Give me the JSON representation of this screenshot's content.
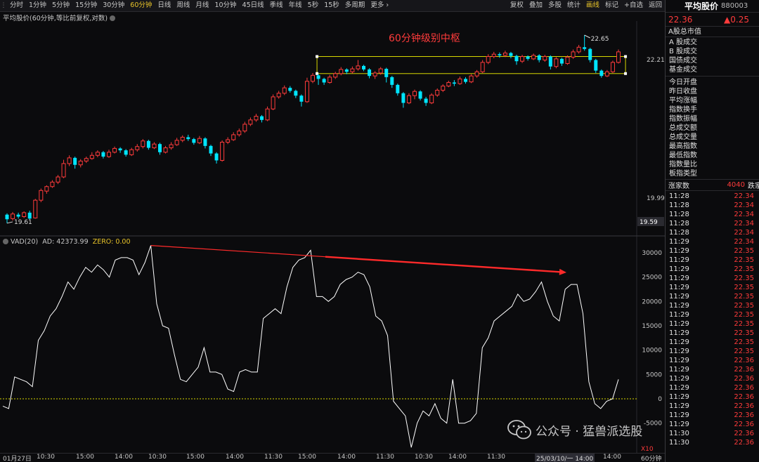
{
  "toolbar": {
    "tabs": [
      "分时",
      "1分钟",
      "5分钟",
      "15分钟",
      "30分钟",
      "60分钟",
      "日线",
      "周线",
      "月线",
      "10分钟",
      "45日线",
      "季线",
      "年线",
      "5秒",
      "15秒",
      "多周期",
      "更多 ›"
    ],
    "active_tab": "60分钟",
    "buttons": [
      "复权",
      "叠加",
      "多股",
      "统计",
      "画线",
      "标记",
      "+自选",
      "返回"
    ],
    "active_button": "画线"
  },
  "main_chart": {
    "title": "平均股价(60分钟,等比前复权,对数)",
    "annotation": "60分钟级别中枢",
    "high_label": "22.65",
    "low_label": "19.61",
    "axis_ticks": [
      "22.21",
      "19.99"
    ],
    "current_value_box": "19.59",
    "colors": {
      "up": "#ff3b3b",
      "down": "#00e5ff",
      "box": "#d8d800",
      "annotation": "#ff3b3b"
    },
    "candles": [
      {
        "o": 19.73,
        "c": 19.66,
        "h": 19.75,
        "l": 19.6
      },
      {
        "o": 19.67,
        "c": 19.74,
        "h": 19.77,
        "l": 19.64
      },
      {
        "o": 19.73,
        "c": 19.7,
        "h": 19.76,
        "l": 19.67
      },
      {
        "o": 19.7,
        "c": 19.76,
        "h": 19.78,
        "l": 19.68
      },
      {
        "o": 19.76,
        "c": 19.67,
        "h": 19.79,
        "l": 19.66
      },
      {
        "o": 19.68,
        "c": 19.95,
        "h": 19.97,
        "l": 19.67
      },
      {
        "o": 19.95,
        "c": 20.1,
        "h": 20.13,
        "l": 19.92
      },
      {
        "o": 20.09,
        "c": 20.16,
        "h": 20.18,
        "l": 20.05
      },
      {
        "o": 20.16,
        "c": 20.23,
        "h": 20.26,
        "l": 20.14
      },
      {
        "o": 20.23,
        "c": 20.31,
        "h": 20.34,
        "l": 20.2
      },
      {
        "o": 20.31,
        "c": 20.52,
        "h": 20.58,
        "l": 20.29
      },
      {
        "o": 20.52,
        "c": 20.61,
        "h": 20.65,
        "l": 20.48
      },
      {
        "o": 20.61,
        "c": 20.5,
        "h": 20.63,
        "l": 20.44
      },
      {
        "o": 20.5,
        "c": 20.56,
        "h": 20.59,
        "l": 20.46
      },
      {
        "o": 20.56,
        "c": 20.6,
        "h": 20.63,
        "l": 20.53
      },
      {
        "o": 20.6,
        "c": 20.65,
        "h": 20.7,
        "l": 20.58
      },
      {
        "o": 20.65,
        "c": 20.7,
        "h": 20.73,
        "l": 20.62
      },
      {
        "o": 20.7,
        "c": 20.63,
        "h": 20.72,
        "l": 20.6
      },
      {
        "o": 20.63,
        "c": 20.7,
        "h": 20.74,
        "l": 20.61
      },
      {
        "o": 20.7,
        "c": 20.76,
        "h": 20.79,
        "l": 20.68
      },
      {
        "o": 20.76,
        "c": 20.73,
        "h": 20.78,
        "l": 20.69
      },
      {
        "o": 20.73,
        "c": 20.66,
        "h": 20.75,
        "l": 20.63
      },
      {
        "o": 20.66,
        "c": 20.74,
        "h": 20.77,
        "l": 20.64
      },
      {
        "o": 20.74,
        "c": 20.79,
        "h": 20.83,
        "l": 20.71
      },
      {
        "o": 20.79,
        "c": 20.88,
        "h": 20.91,
        "l": 20.76
      },
      {
        "o": 20.88,
        "c": 20.77,
        "h": 20.9,
        "l": 20.74
      },
      {
        "o": 20.77,
        "c": 20.83,
        "h": 20.86,
        "l": 20.75
      },
      {
        "o": 20.83,
        "c": 20.7,
        "h": 20.85,
        "l": 20.66
      },
      {
        "o": 20.7,
        "c": 20.77,
        "h": 20.8,
        "l": 20.68
      },
      {
        "o": 20.77,
        "c": 20.82,
        "h": 20.86,
        "l": 20.74
      },
      {
        "o": 20.82,
        "c": 20.89,
        "h": 20.93,
        "l": 20.8
      },
      {
        "o": 20.89,
        "c": 20.94,
        "h": 20.97,
        "l": 20.86
      },
      {
        "o": 20.94,
        "c": 20.91,
        "h": 20.98,
        "l": 20.88
      },
      {
        "o": 20.91,
        "c": 20.85,
        "h": 20.93,
        "l": 20.82
      },
      {
        "o": 20.85,
        "c": 20.92,
        "h": 20.96,
        "l": 20.83
      },
      {
        "o": 20.92,
        "c": 20.8,
        "h": 20.94,
        "l": 20.76
      },
      {
        "o": 20.8,
        "c": 20.68,
        "h": 20.82,
        "l": 20.64
      },
      {
        "o": 20.68,
        "c": 20.57,
        "h": 20.7,
        "l": 20.52
      },
      {
        "o": 20.57,
        "c": 20.86,
        "h": 20.89,
        "l": 20.55
      },
      {
        "o": 20.86,
        "c": 20.9,
        "h": 20.94,
        "l": 20.83
      },
      {
        "o": 20.9,
        "c": 20.98,
        "h": 21.02,
        "l": 20.88
      },
      {
        "o": 20.98,
        "c": 21.04,
        "h": 21.08,
        "l": 20.95
      },
      {
        "o": 21.04,
        "c": 21.15,
        "h": 21.19,
        "l": 21.01
      },
      {
        "o": 21.15,
        "c": 21.22,
        "h": 21.26,
        "l": 21.12
      },
      {
        "o": 21.22,
        "c": 21.28,
        "h": 21.32,
        "l": 21.19
      },
      {
        "o": 21.28,
        "c": 21.22,
        "h": 21.3,
        "l": 21.18
      },
      {
        "o": 21.22,
        "c": 21.4,
        "h": 21.44,
        "l": 21.2
      },
      {
        "o": 21.4,
        "c": 21.6,
        "h": 21.64,
        "l": 21.38
      },
      {
        "o": 21.6,
        "c": 21.66,
        "h": 21.7,
        "l": 21.57
      },
      {
        "o": 21.66,
        "c": 21.75,
        "h": 21.79,
        "l": 21.63
      },
      {
        "o": 21.75,
        "c": 21.7,
        "h": 21.78,
        "l": 21.67
      },
      {
        "o": 21.7,
        "c": 21.62,
        "h": 21.72,
        "l": 21.58
      },
      {
        "o": 21.62,
        "c": 21.52,
        "h": 21.64,
        "l": 21.44
      },
      {
        "o": 21.52,
        "c": 21.86,
        "h": 21.92,
        "l": 21.5
      },
      {
        "o": 21.86,
        "c": 21.96,
        "h": 22.0,
        "l": 21.83
      },
      {
        "o": 21.96,
        "c": 21.9,
        "h": 21.98,
        "l": 21.8
      },
      {
        "o": 21.9,
        "c": 21.84,
        "h": 21.92,
        "l": 21.8
      },
      {
        "o": 21.84,
        "c": 21.93,
        "h": 21.97,
        "l": 21.82
      },
      {
        "o": 21.93,
        "c": 21.99,
        "h": 22.02,
        "l": 21.9
      },
      {
        "o": 21.99,
        "c": 22.06,
        "h": 22.1,
        "l": 21.96
      },
      {
        "o": 22.06,
        "c": 22.02,
        "h": 22.08,
        "l": 21.98
      },
      {
        "o": 22.02,
        "c": 22.07,
        "h": 22.11,
        "l": 21.99
      },
      {
        "o": 22.07,
        "c": 22.12,
        "h": 22.22,
        "l": 22.04
      },
      {
        "o": 22.12,
        "c": 22.06,
        "h": 22.14,
        "l": 22.03
      },
      {
        "o": 22.06,
        "c": 21.95,
        "h": 22.08,
        "l": 21.91
      },
      {
        "o": 21.95,
        "c": 22.0,
        "h": 22.03,
        "l": 21.9
      },
      {
        "o": 22.0,
        "c": 22.07,
        "h": 22.1,
        "l": 21.97
      },
      {
        "o": 22.07,
        "c": 21.93,
        "h": 22.09,
        "l": 21.84
      },
      {
        "o": 21.93,
        "c": 21.8,
        "h": 21.95,
        "l": 21.75
      },
      {
        "o": 21.8,
        "c": 21.66,
        "h": 21.82,
        "l": 21.62
      },
      {
        "o": 21.66,
        "c": 21.5,
        "h": 21.68,
        "l": 21.42
      },
      {
        "o": 21.5,
        "c": 21.62,
        "h": 21.66,
        "l": 21.48
      },
      {
        "o": 21.62,
        "c": 21.69,
        "h": 21.72,
        "l": 21.56
      },
      {
        "o": 21.69,
        "c": 21.57,
        "h": 21.71,
        "l": 21.54
      },
      {
        "o": 21.57,
        "c": 21.5,
        "h": 21.6,
        "l": 21.45
      },
      {
        "o": 21.5,
        "c": 21.63,
        "h": 21.66,
        "l": 21.48
      },
      {
        "o": 21.63,
        "c": 21.71,
        "h": 21.74,
        "l": 21.6
      },
      {
        "o": 21.71,
        "c": 21.78,
        "h": 21.81,
        "l": 21.68
      },
      {
        "o": 21.78,
        "c": 21.84,
        "h": 21.87,
        "l": 21.76
      },
      {
        "o": 21.84,
        "c": 21.82,
        "h": 21.88,
        "l": 21.78
      },
      {
        "o": 21.82,
        "c": 21.9,
        "h": 21.94,
        "l": 21.8
      },
      {
        "o": 21.9,
        "c": 21.85,
        "h": 21.93,
        "l": 21.82
      },
      {
        "o": 21.85,
        "c": 21.95,
        "h": 21.98,
        "l": 21.83
      },
      {
        "o": 21.95,
        "c": 22.02,
        "h": 22.05,
        "l": 21.92
      },
      {
        "o": 22.02,
        "c": 22.18,
        "h": 22.22,
        "l": 22.0
      },
      {
        "o": 22.18,
        "c": 22.28,
        "h": 22.32,
        "l": 22.15
      },
      {
        "o": 22.28,
        "c": 22.32,
        "h": 22.36,
        "l": 22.25
      },
      {
        "o": 22.32,
        "c": 22.3,
        "h": 22.35,
        "l": 22.26
      },
      {
        "o": 22.3,
        "c": 22.34,
        "h": 22.38,
        "l": 22.27
      },
      {
        "o": 22.34,
        "c": 22.29,
        "h": 22.36,
        "l": 22.25
      },
      {
        "o": 22.29,
        "c": 22.2,
        "h": 22.31,
        "l": 22.14
      },
      {
        "o": 22.2,
        "c": 22.28,
        "h": 22.31,
        "l": 22.17
      },
      {
        "o": 22.28,
        "c": 22.24,
        "h": 22.3,
        "l": 22.21
      },
      {
        "o": 22.24,
        "c": 22.3,
        "h": 22.33,
        "l": 22.22
      },
      {
        "o": 22.3,
        "c": 22.22,
        "h": 22.32,
        "l": 22.18
      },
      {
        "o": 22.22,
        "c": 22.28,
        "h": 22.31,
        "l": 22.19
      },
      {
        "o": 22.28,
        "c": 22.11,
        "h": 22.3,
        "l": 22.06
      },
      {
        "o": 22.11,
        "c": 22.24,
        "h": 22.27,
        "l": 22.08
      },
      {
        "o": 22.24,
        "c": 22.16,
        "h": 22.26,
        "l": 22.12
      },
      {
        "o": 22.16,
        "c": 22.27,
        "h": 22.3,
        "l": 22.14
      },
      {
        "o": 22.27,
        "c": 22.36,
        "h": 22.4,
        "l": 22.24
      },
      {
        "o": 22.36,
        "c": 22.44,
        "h": 22.48,
        "l": 22.33
      },
      {
        "o": 22.44,
        "c": 22.41,
        "h": 22.65,
        "l": 22.38
      },
      {
        "o": 22.41,
        "c": 22.22,
        "h": 22.43,
        "l": 22.18
      },
      {
        "o": 22.22,
        "c": 22.04,
        "h": 22.24,
        "l": 22.0
      },
      {
        "o": 22.04,
        "c": 21.95,
        "h": 22.06,
        "l": 21.92
      },
      {
        "o": 21.95,
        "c": 22.02,
        "h": 22.05,
        "l": 21.93
      },
      {
        "o": 22.02,
        "c": 22.18,
        "h": 22.21,
        "l": 22.0
      },
      {
        "o": 22.18,
        "c": 22.36,
        "h": 22.4,
        "l": 22.16
      }
    ],
    "zhongshu": {
      "upper": 22.28,
      "lower": 21.99,
      "start_index": 55,
      "end_index": 109
    }
  },
  "indicator": {
    "name": "VAD(20)",
    "ad_label": "AD: 42373.99",
    "zero_label": "ZERO: 0.00",
    "axis_ticks": [
      "30000",
      "25000",
      "20000",
      "15000",
      "10000",
      "5000",
      "0",
      "-5000"
    ],
    "multiplier": "X10",
    "line_color": "#ffffff",
    "divergence_arrow_color": "#ff2a2a",
    "values": [
      -1500,
      -2000,
      4500,
      4000,
      3500,
      2500,
      12000,
      14000,
      17000,
      18500,
      21000,
      24000,
      22500,
      25000,
      27000,
      26000,
      27500,
      26500,
      25000,
      28500,
      29000,
      29000,
      28500,
      25500,
      28000,
      31500,
      19500,
      15000,
      14500,
      9000,
      4000,
      3500,
      5000,
      6500,
      10500,
      5500,
      5500,
      5000,
      2000,
      1500,
      5500,
      6000,
      5500,
      5500,
      16500,
      17500,
      18500,
      17500,
      23000,
      27000,
      28500,
      29000,
      30500,
      21000,
      21000,
      20000,
      21000,
      23500,
      24500,
      25000,
      26000,
      25500,
      23000,
      17000,
      16000,
      13000,
      -500,
      -2000,
      -3500,
      -10000,
      -5000,
      -2500,
      -3500,
      -1000,
      -4000,
      -5000,
      4000,
      -5000,
      -5000,
      -4500,
      -3000,
      10500,
      12500,
      16000,
      17000,
      18000,
      19000,
      21500,
      20000,
      20500,
      22000,
      24000,
      20000,
      17000,
      16000,
      22500,
      23500,
      23500,
      17500,
      3500,
      -1000,
      -2000,
      -500,
      0,
      4000
    ],
    "zero_line_color": "#d8d800"
  },
  "time_axis": [
    "01月27日",
    "10:30",
    "15:00",
    "14:00",
    "10:30",
    "15:00",
    "14:00",
    "11:30",
    "15:00",
    "14:00",
    "11:30",
    "10:30",
    "14:00",
    "11:30",
    "10:",
    "25/03/10/一 14:00",
    "14:00"
  ],
  "time_axis_right": "60分钟",
  "right_panel": {
    "name": "平均股价",
    "code": "880003",
    "price": "22.36",
    "change": "▲0.25",
    "section_title": "A股总市值",
    "group1": [
      "A 股成交",
      "B 股成交",
      "国债成交",
      "基金成交"
    ],
    "group2": [
      "今日开盘",
      "昨日收盘",
      "平均涨幅",
      "指数换手",
      "指数振幅",
      "总成交额",
      "总成交量",
      "最高指数",
      "最低指数",
      "指数量比",
      "板指类型"
    ],
    "up_count_label": "涨家数",
    "up_count": "4040",
    "down_count_label": "跌家",
    "ticks": [
      [
        "11:28",
        "22.34"
      ],
      [
        "11:28",
        "22.34"
      ],
      [
        "11:28",
        "22.34"
      ],
      [
        "11:28",
        "22.34"
      ],
      [
        "11:28",
        "22.34"
      ],
      [
        "11:29",
        "22.34"
      ],
      [
        "11:29",
        "22.35"
      ],
      [
        "11:29",
        "22.35"
      ],
      [
        "11:29",
        "22.35"
      ],
      [
        "11:29",
        "22.35"
      ],
      [
        "11:29",
        "22.35"
      ],
      [
        "11:29",
        "22.35"
      ],
      [
        "11:29",
        "22.35"
      ],
      [
        "11:29",
        "22.35"
      ],
      [
        "11:29",
        "22.35"
      ],
      [
        "11:29",
        "22.35"
      ],
      [
        "11:29",
        "22.35"
      ],
      [
        "11:29",
        "22.35"
      ],
      [
        "11:29",
        "22.36"
      ],
      [
        "11:29",
        "22.36"
      ],
      [
        "11:29",
        "22.36"
      ],
      [
        "11:29",
        "22.36"
      ],
      [
        "11:29",
        "22.36"
      ],
      [
        "11:29",
        "22.36"
      ],
      [
        "11:29",
        "22.36"
      ],
      [
        "11:29",
        "22.36"
      ],
      [
        "11:30",
        "22.36"
      ],
      [
        "11:30",
        "22.36"
      ]
    ]
  },
  "watermark": {
    "text": "公众号 · 猛兽派选股"
  }
}
